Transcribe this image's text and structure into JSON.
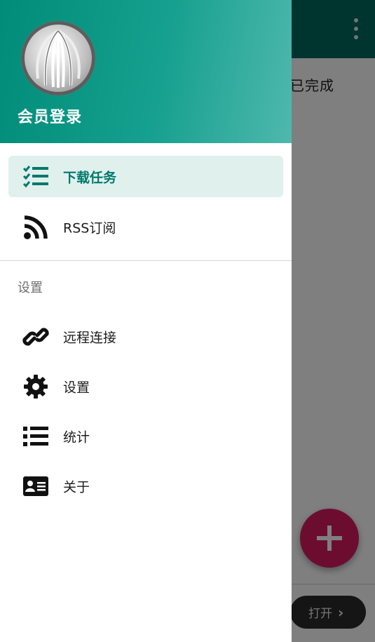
{
  "app": {
    "tab_completed": "已完成",
    "open_label": "打开",
    "open_chevron": "›",
    "overflow_icon": "more-vert-icon",
    "fab_icon": "plus-icon"
  },
  "drawer": {
    "header_title": "会员登录",
    "avatar_icon": "app-logo-icon",
    "primary_items": [
      {
        "label": "下载任务",
        "icon": "task-list-icon",
        "active": true
      },
      {
        "label": "RSS订阅",
        "icon": "rss-icon",
        "active": false
      }
    ],
    "section_title": "设置",
    "settings_items": [
      {
        "label": "远程连接",
        "icon": "link-icon"
      },
      {
        "label": "设置",
        "icon": "gear-icon"
      },
      {
        "label": "统计",
        "icon": "list-icon"
      },
      {
        "label": "关于",
        "icon": "id-card-icon"
      }
    ]
  },
  "colors": {
    "app_bar": "#00695c",
    "header_gradient_start": "#008c79",
    "header_gradient_end": "#4fb8ad",
    "active_item_bg": "#e0f0ed",
    "active_item_text": "#00796b",
    "fab": "#d81b60",
    "scrim": "rgba(0,0,0,0.5)"
  }
}
